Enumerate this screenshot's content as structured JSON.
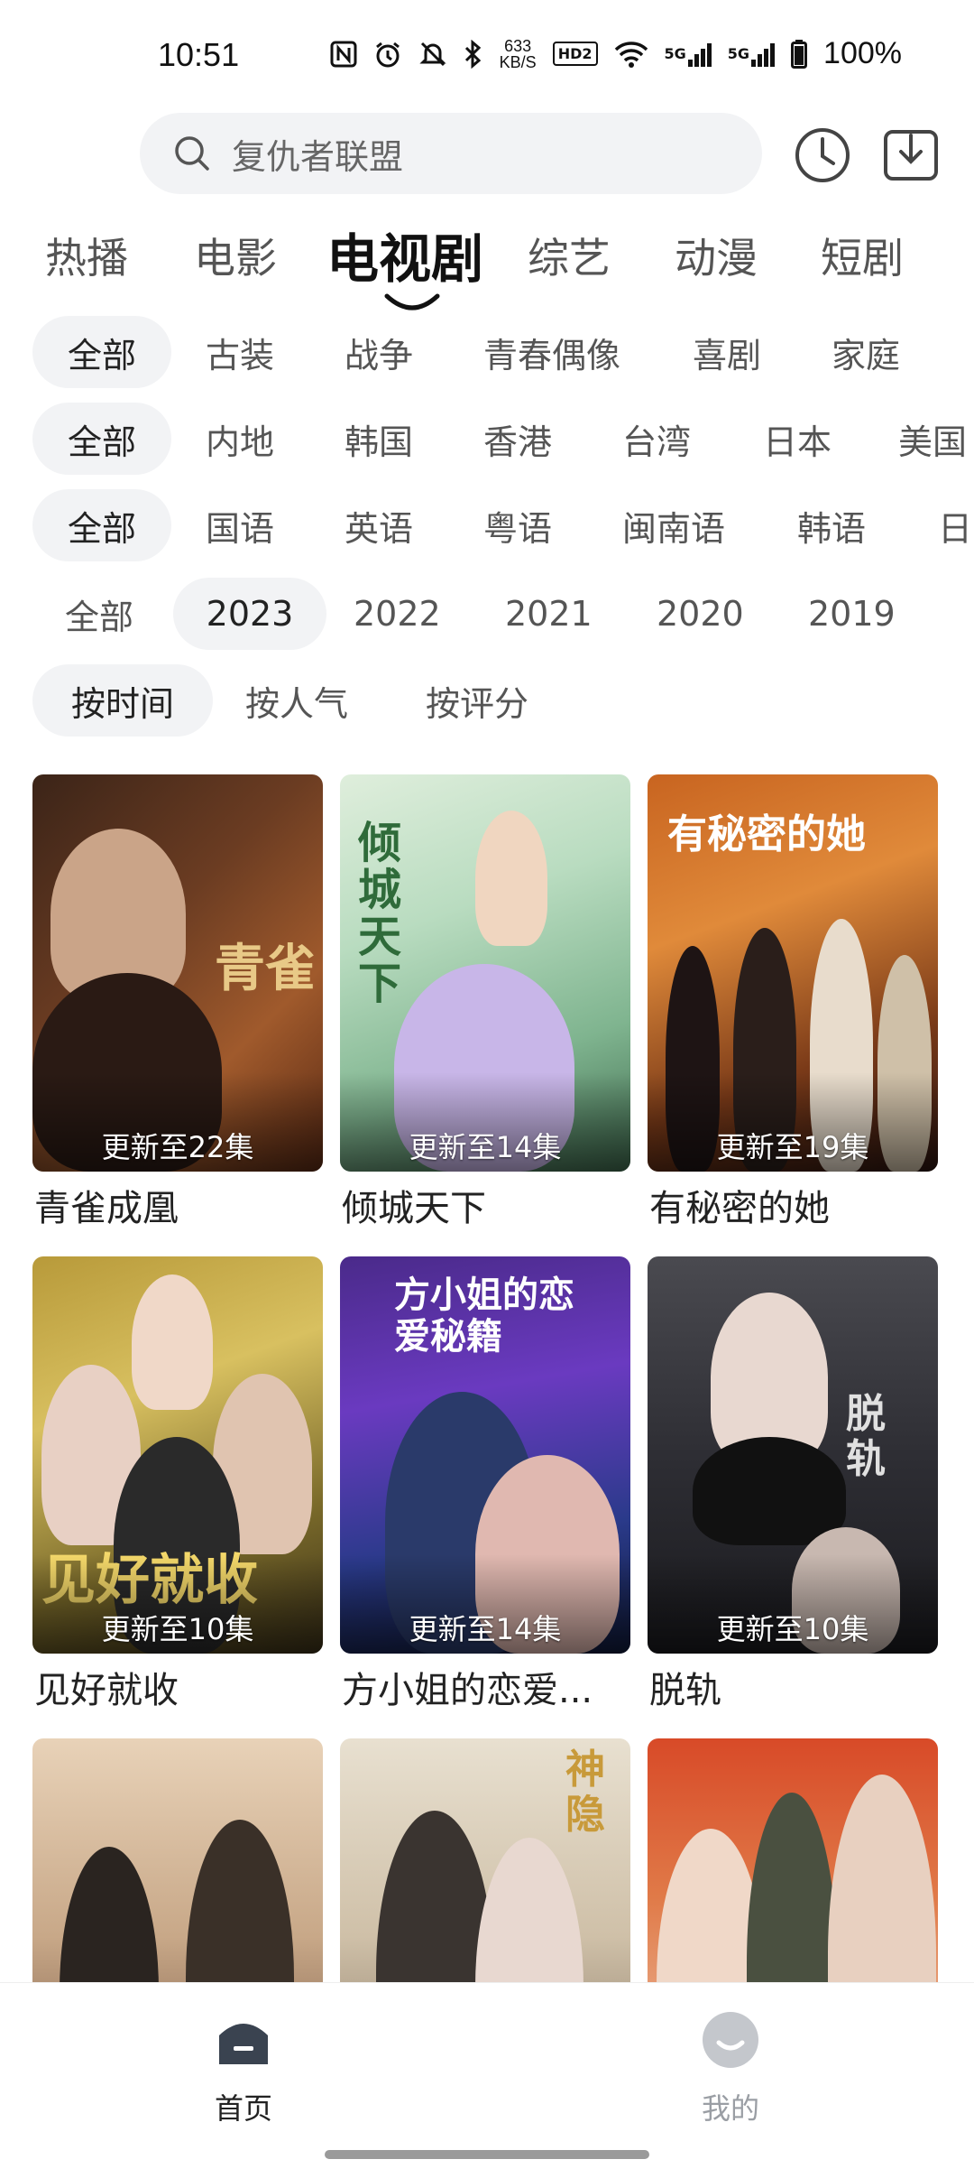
{
  "status_bar": {
    "time": "10:51",
    "net_speed_value": "633",
    "net_speed_unit": "KB/S",
    "hd_label": "HD2",
    "signal1": "5G",
    "signal2": "5G",
    "battery": "100%"
  },
  "search": {
    "placeholder": "复仇者联盟"
  },
  "tabs": [
    {
      "label": "热播"
    },
    {
      "label": "电影"
    },
    {
      "label": "电视剧",
      "active": true
    },
    {
      "label": "综艺"
    },
    {
      "label": "动漫"
    },
    {
      "label": "短剧"
    }
  ],
  "filters": {
    "genre": [
      "全部",
      "古装",
      "战争",
      "青春偶像",
      "喜剧",
      "家庭"
    ],
    "region": [
      "全部",
      "内地",
      "韩国",
      "香港",
      "台湾",
      "日本",
      "美国"
    ],
    "language": [
      "全部",
      "国语",
      "英语",
      "粤语",
      "闽南语",
      "韩语",
      "日"
    ],
    "year": [
      "全部",
      "2023",
      "2022",
      "2021",
      "2020",
      "2019"
    ],
    "sort": [
      "按时间",
      "按人气",
      "按评分"
    ],
    "selected": {
      "genre": "全部",
      "region": "全部",
      "language": "全部",
      "year": "2023",
      "sort": "按时间"
    }
  },
  "cards": [
    {
      "title": "青雀成凰",
      "badge": "更新至22集",
      "poster_text": "青雀"
    },
    {
      "title": "倾城天下",
      "badge": "更新至14集",
      "poster_text": "倾城天下"
    },
    {
      "title": "有秘密的她",
      "badge": "更新至19集",
      "poster_text": "有秘密的她"
    },
    {
      "title": "见好就收",
      "badge": "更新至10集",
      "poster_text": "见好就收"
    },
    {
      "title": "方小姐的恋爱...",
      "badge": "更新至14集",
      "poster_text": "方小姐的恋爱秘籍"
    },
    {
      "title": "脱轨",
      "badge": "更新至10集",
      "poster_text": "脱轨"
    },
    {
      "title": "",
      "badge": "",
      "poster_text": ""
    },
    {
      "title": "",
      "badge": "",
      "poster_text": "神隐"
    },
    {
      "title": "",
      "badge": "",
      "poster_text": ""
    }
  ],
  "bottom_nav": [
    {
      "label": "首页",
      "active": true
    },
    {
      "label": "我的",
      "active": false
    }
  ],
  "colors": {
    "chip_bg": "#f2f3f5",
    "text_primary": "#222222",
    "text_secondary": "#555555",
    "nav_active": "#3a4350",
    "nav_inactive": "#b9bcc2"
  }
}
